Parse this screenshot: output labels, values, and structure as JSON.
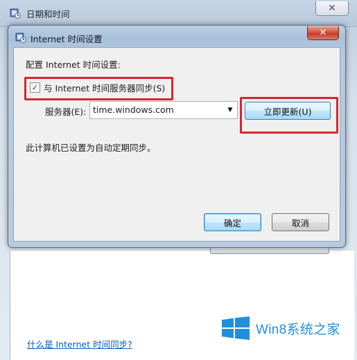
{
  "background_window": {
    "title": "日期和时间",
    "close_glyph": "✕",
    "help_link": "什么是 Internet 时间同步?",
    "watermark": "Win8系统之家"
  },
  "dialog": {
    "title": "Internet 时间设置",
    "close_glyph": "✕",
    "config_label": "配置 Internet 时间设置:",
    "sync_checkbox": {
      "label": "与 Internet 时间服务器同步(S)",
      "checked": true,
      "check_glyph": "✓"
    },
    "server": {
      "label": "服务器(E):",
      "value": "time.windows.com",
      "dropdown_glyph": "▼"
    },
    "update_button": "立即更新(U)",
    "status_text": "此计算机已设置为自动定期同步。",
    "ok_button": "确定",
    "cancel_button": "取消"
  },
  "colors": {
    "highlight": "#d9252f",
    "link": "#0b58b8",
    "watermark": "#1f8fdc"
  },
  "icons": [
    "clock-globe-icon",
    "close-icon",
    "checkmark-icon",
    "dropdown-arrow-icon",
    "windows-logo-icon"
  ]
}
